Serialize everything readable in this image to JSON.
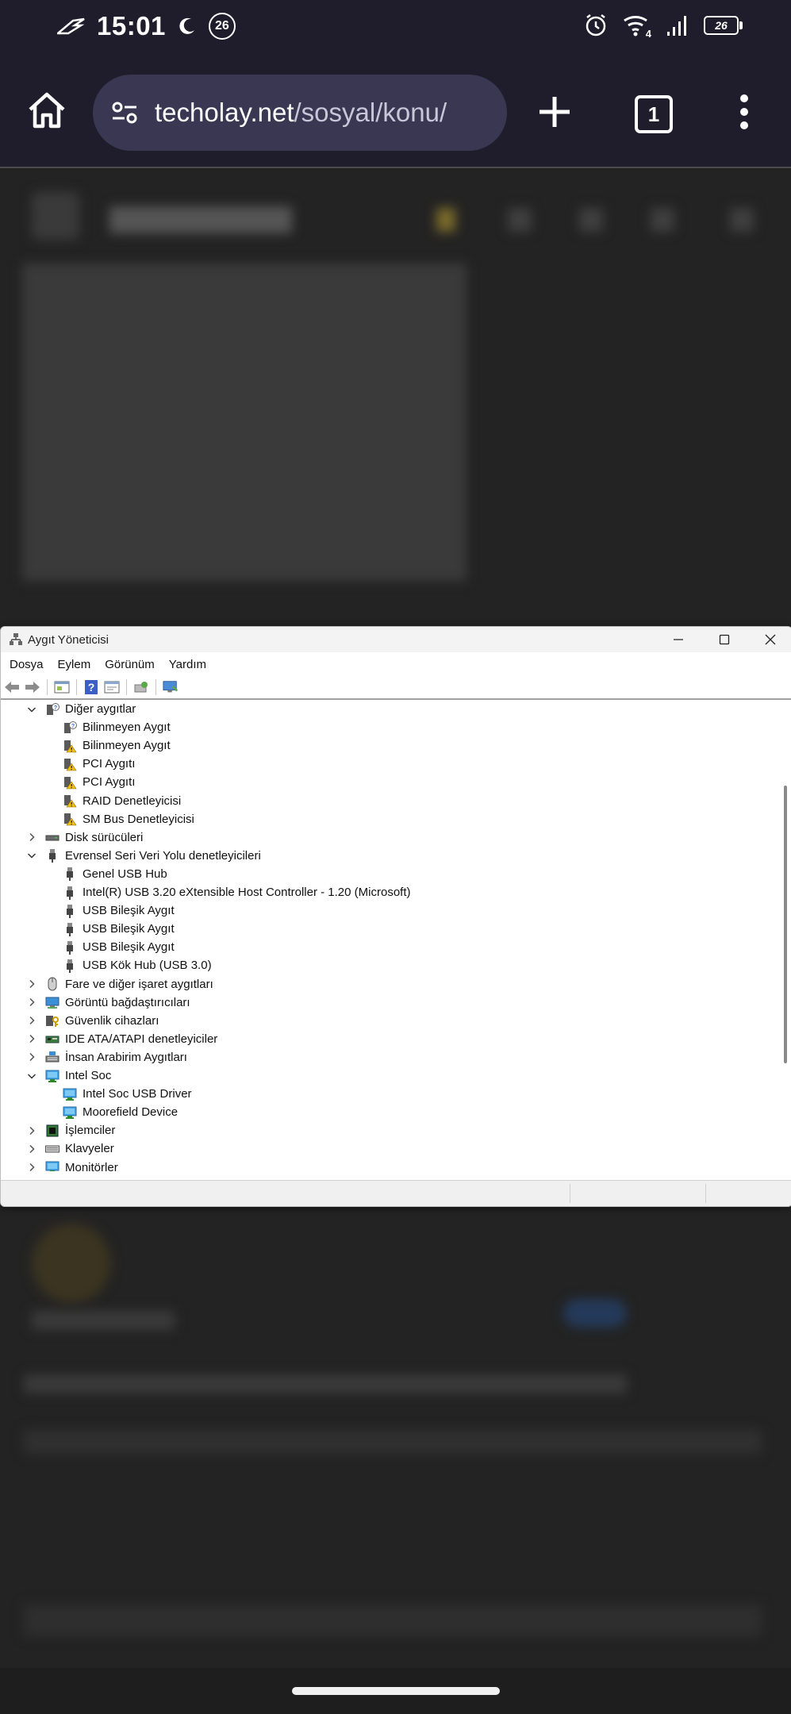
{
  "status_bar": {
    "time": "15:01",
    "notification_count": "26",
    "battery": "26",
    "wifi_label": "4"
  },
  "browser": {
    "url_domain": "techolay.net",
    "url_path": "/sosyal/konu/",
    "tab_count": "1"
  },
  "device_manager": {
    "title": "Aygıt Yöneticisi",
    "menu": [
      "Dosya",
      "Eylem",
      "Görünüm",
      "Yardım"
    ],
    "tree": [
      {
        "label": "Diğer aygıtlar",
        "level": 0,
        "state": "expanded",
        "icon": "other-devices-icon"
      },
      {
        "label": "Bilinmeyen Aygıt",
        "level": 1,
        "state": "leaf",
        "icon": "unknown-device-icon"
      },
      {
        "label": "Bilinmeyen Aygıt",
        "level": 1,
        "state": "leaf",
        "icon": "warning-device-icon"
      },
      {
        "label": "PCI Aygıtı",
        "level": 1,
        "state": "leaf",
        "icon": "warning-device-icon"
      },
      {
        "label": "PCI Aygıtı",
        "level": 1,
        "state": "leaf",
        "icon": "warning-device-icon"
      },
      {
        "label": "RAID Denetleyicisi",
        "level": 1,
        "state": "leaf",
        "icon": "warning-device-icon"
      },
      {
        "label": "SM Bus Denetleyicisi",
        "level": 1,
        "state": "leaf",
        "icon": "warning-device-icon"
      },
      {
        "label": "Disk sürücüleri",
        "level": 0,
        "state": "collapsed",
        "icon": "disk-drive-icon"
      },
      {
        "label": "Evrensel Seri Veri Yolu denetleyicileri",
        "level": 0,
        "state": "expanded",
        "icon": "usb-icon"
      },
      {
        "label": "Genel USB Hub",
        "level": 1,
        "state": "leaf",
        "icon": "usb-icon"
      },
      {
        "label": "Intel(R) USB 3.20 eXtensible Host Controller - 1.20 (Microsoft)",
        "level": 1,
        "state": "leaf",
        "icon": "usb-icon"
      },
      {
        "label": "USB Bileşik Aygıt",
        "level": 1,
        "state": "leaf",
        "icon": "usb-icon"
      },
      {
        "label": "USB Bileşik Aygıt",
        "level": 1,
        "state": "leaf",
        "icon": "usb-icon"
      },
      {
        "label": "USB Bileşik Aygıt",
        "level": 1,
        "state": "leaf",
        "icon": "usb-icon"
      },
      {
        "label": "USB Kök Hub (USB 3.0)",
        "level": 1,
        "state": "leaf",
        "icon": "usb-icon"
      },
      {
        "label": "Fare ve diğer işaret aygıtları",
        "level": 0,
        "state": "collapsed",
        "icon": "mouse-icon"
      },
      {
        "label": "Görüntü bağdaştırıcıları",
        "level": 0,
        "state": "collapsed",
        "icon": "display-adapter-icon"
      },
      {
        "label": "Güvenlik cihazları",
        "level": 0,
        "state": "collapsed",
        "icon": "security-device-icon"
      },
      {
        "label": "IDE ATA/ATAPI denetleyiciler",
        "level": 0,
        "state": "collapsed",
        "icon": "ide-controller-icon"
      },
      {
        "label": "İnsan Arabirim Aygıtları",
        "level": 0,
        "state": "collapsed",
        "icon": "hid-icon"
      },
      {
        "label": "Intel Soc",
        "level": 0,
        "state": "expanded",
        "icon": "monitor-icon"
      },
      {
        "label": "Intel Soc USB Driver",
        "level": 1,
        "state": "leaf",
        "icon": "monitor-icon"
      },
      {
        "label": "Moorefield Device",
        "level": 1,
        "state": "leaf",
        "icon": "monitor-icon"
      },
      {
        "label": "İşlemciler",
        "level": 0,
        "state": "collapsed",
        "icon": "processor-icon"
      },
      {
        "label": "Klavyeler",
        "level": 0,
        "state": "collapsed",
        "icon": "keyboard-icon"
      },
      {
        "label": "Monitörler",
        "level": 0,
        "state": "collapsed",
        "icon": "monitor-icon"
      }
    ]
  },
  "colors": {
    "status_bar_bg": "#1f1d2b",
    "url_bar_bg": "#3a3752",
    "page_bg": "#232323",
    "warning_yellow": "#f2c200",
    "usb_gray": "#555555"
  }
}
